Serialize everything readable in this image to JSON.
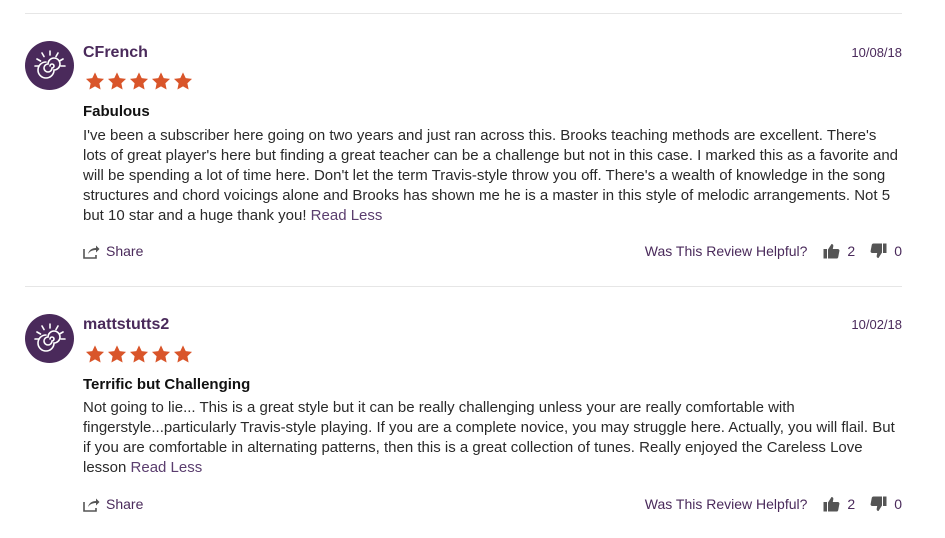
{
  "colors": {
    "brand_purple": "#4a2a5b",
    "star_orange": "#d9552a",
    "divider": "#e6e6e6"
  },
  "reviews": [
    {
      "username": "CFrench",
      "date": "10/08/18",
      "rating": 5,
      "title": "Fabulous",
      "body": "I've been a subscriber here going on two years and just ran across this. Brooks teaching methods are excellent. There's lots of great player's here but finding a great teacher can be a challenge but not in this case. I marked this as a favorite and will be spending a lot of time here. Don't let the term Travis-style throw you off. There's a wealth of knowledge in the song structures and chord voicings alone and Brooks has shown me he is a master in this style of melodic arrangements. Not 5 but 10 star and a huge thank you!",
      "read_less": "Read Less",
      "share_label": "Share",
      "helpful_label": "Was This Review Helpful?",
      "upvotes": "2",
      "downvotes": "0"
    },
    {
      "username": "mattstutts2",
      "date": "10/02/18",
      "rating": 5,
      "title": "Terrific but Challenging",
      "body": "Not going to lie... This is a great style but it can be really challenging unless your are really comfortable with fingerstyle...particularly Travis-style playing. If you are a complete novice, you may struggle here. Actually, you will flail. But if you are comfortable in alternating patterns, then this is a great collection of tunes. Really enjoyed the Careless Love lesson",
      "read_less": "Read Less",
      "share_label": "Share",
      "helpful_label": "Was This Review Helpful?",
      "upvotes": "2",
      "downvotes": "0"
    }
  ]
}
